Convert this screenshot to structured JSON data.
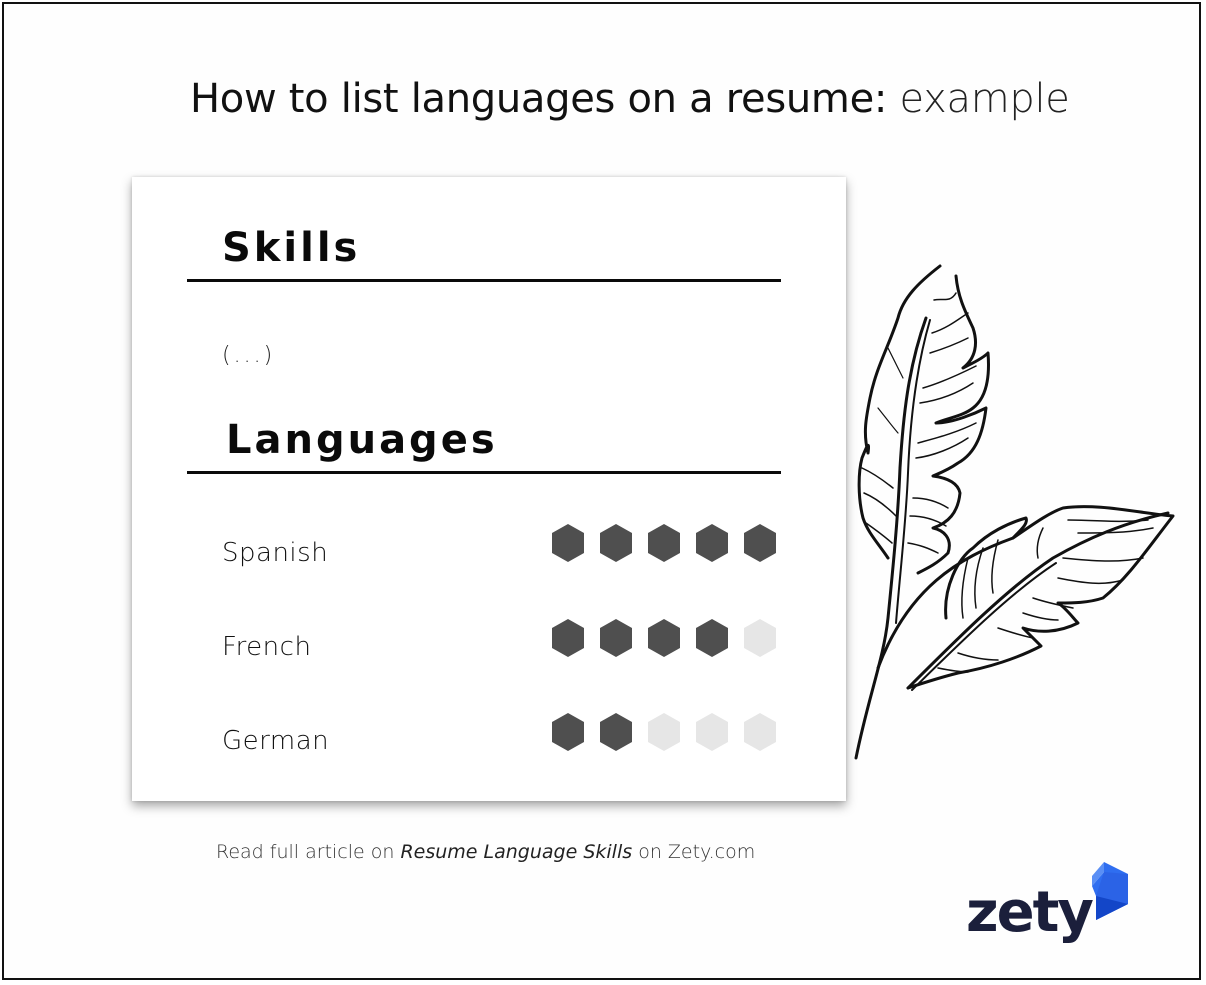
{
  "header": {
    "title_strong": "How to list languages on a resume:",
    "title_light": "example"
  },
  "resume": {
    "skills_heading": "Skills",
    "skills_placeholder": "(...)",
    "languages_heading": "Languages",
    "languages": [
      {
        "name": "Spanish",
        "level": 5,
        "max": 5
      },
      {
        "name": "French",
        "level": 4,
        "max": 5
      },
      {
        "name": "German",
        "level": 2,
        "max": 5
      }
    ],
    "rating_colors": {
      "filled": "#4f4f4f",
      "empty": "#e6e6e6"
    }
  },
  "footer": {
    "prefix": "Read full article on",
    "link": "Resume Language Skills",
    "suffix": "on Zety.com"
  },
  "brand": {
    "name": "zety",
    "logo_icon": "zety-cube-icon",
    "colors": {
      "text": "#1b1f3b",
      "blue": "#2f6ef0",
      "blue_dark": "#1346c8"
    }
  },
  "decoration": {
    "icon": "feather-leaves-icon"
  }
}
